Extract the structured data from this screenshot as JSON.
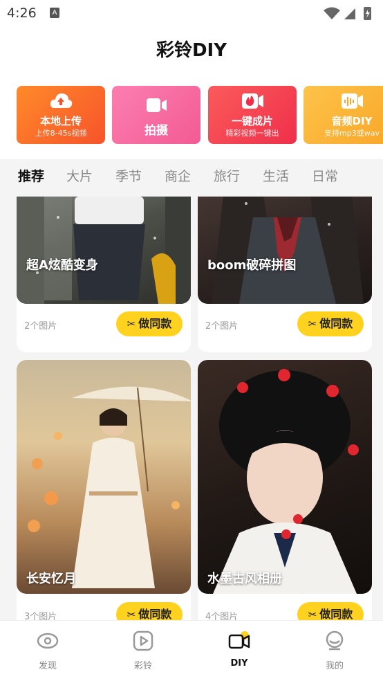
{
  "status": {
    "time": "4:26",
    "notif_glyph": "A"
  },
  "app": {
    "title": "彩铃DIY"
  },
  "quick_actions": [
    {
      "title": "本地上传",
      "subtitle": "上传8-45s视频",
      "icon": "cloud-upload-icon"
    },
    {
      "title": "拍摄",
      "subtitle": "",
      "icon": "video-camera-icon"
    },
    {
      "title": "一键成片",
      "subtitle": "精彩视频一键出",
      "icon": "flame-camera-icon"
    },
    {
      "title": "音频DIY",
      "subtitle": "支持mp3或wav",
      "icon": "audio-wave-icon"
    }
  ],
  "tabs": [
    "推荐",
    "大片",
    "季节",
    "商企",
    "旅行",
    "生活",
    "日常"
  ],
  "active_tab": "推荐",
  "cards": [
    {
      "title": "超A炫酷变身",
      "count": "2个图片",
      "button": "做同款"
    },
    {
      "title": "boom破碎拼图",
      "count": "2个图片",
      "button": "做同款"
    },
    {
      "title": "长安忆月",
      "count": "3个图片",
      "button": "做同款"
    },
    {
      "title": "水墨古风相册",
      "count": "4个图片",
      "button": "做同款"
    }
  ],
  "nav": [
    {
      "label": "发现",
      "icon": "eye-icon"
    },
    {
      "label": "彩铃",
      "icon": "play-icon"
    },
    {
      "label": "DIY",
      "icon": "video-camera-icon"
    },
    {
      "label": "我的",
      "icon": "profile-icon"
    }
  ],
  "colors": {
    "accent": "#ffd21f",
    "upload": "#f7532a",
    "shoot": "#f35a94",
    "oneclick": "#ef2f4a",
    "audio": "#f8a526"
  }
}
